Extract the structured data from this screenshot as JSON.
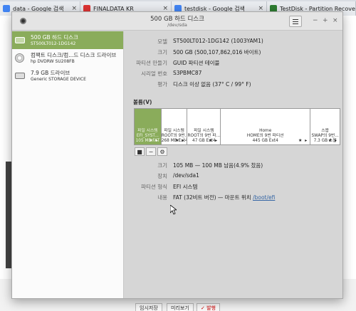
{
  "browser": {
    "tabs": [
      {
        "label": "data - Google 검색",
        "icon_color": "#4285f4"
      },
      {
        "label": "FINALDATA KR",
        "icon_color": "#d33"
      },
      {
        "label": "testdisk - Google 검색",
        "icon_color": "#4285f4"
      },
      {
        "label": "TestDisk - Partition Recover",
        "icon_color": "#2e7d32"
      }
    ],
    "bottom_buttons": [
      "임시저장",
      "미리보기",
      "✓ 발행"
    ]
  },
  "window": {
    "title": "500 GB 하드 디스크",
    "subtitle": "/dev/sda"
  },
  "devices": [
    {
      "name": "500 GB 하드 디스크",
      "detail": "ST500LT012-1DG142",
      "icon": "harddisk-icon",
      "selected": true
    },
    {
      "name": "컴팩트 디스크/컴...드 디스크 드라이브",
      "detail": "hp     DVDRW  SU208FB",
      "icon": "optical-drive-icon",
      "selected": false
    },
    {
      "name": "7.9 GB 드라이브",
      "detail": "Generic STORAGE DEVICE",
      "icon": "usb-drive-icon",
      "selected": false
    }
  ],
  "disk_info": [
    {
      "label": "모델",
      "value": "ST500LT012-1DG142 (1003YAM1)"
    },
    {
      "label": "크기",
      "value": "500 GB (500,107,862,016 바이트)"
    },
    {
      "label": "파티션 만들기",
      "value": "GUID 파티션 테이블"
    },
    {
      "label": "시리얼 번호",
      "value": "S3PBMC87"
    },
    {
      "label": "평가",
      "value": "디스크 이상 없음 (37° C / 99° F)"
    }
  ],
  "volumes_label": "볼륨(V)",
  "partitions": [
    {
      "line1": "파일 시스템",
      "line2": "EFI_SYST...",
      "line3": "105 MB FAT",
      "icons": "★ ▸",
      "selected": true
    },
    {
      "line1": "파일 시스템",
      "line2": "ROOT의 9번...",
      "line3": "268 MB Ext4",
      "icons": "★ ▸",
      "selected": false
    },
    {
      "line1": "파일 시스템",
      "line2": "ROOT의 9번 파...",
      "line3": "47 GB Ext4",
      "icons": "★ ▸",
      "selected": false
    },
    {
      "line1": "Home",
      "line2": "HOME의 9번 파티션",
      "line3": "445 GB Ext4",
      "icons": "★ ▸",
      "selected": false
    },
    {
      "line1": "스왑",
      "line2": "SWAP의 9번...",
      "line3": "7.3 GB 스왑",
      "icons": "★ ▸",
      "selected": false
    }
  ],
  "volume_tools": {
    "stop": "■",
    "remove": "−",
    "settings": "⚙"
  },
  "partition_info": [
    {
      "label": "크기",
      "value": "105 MB — 100 MB 남음(4.9% 찼음)"
    },
    {
      "label": "장치",
      "value": "/dev/sda1"
    },
    {
      "label": "파티션 형식",
      "value": "EFI 시스템"
    },
    {
      "label": "내용",
      "value": "FAT (32비트 버전) — 마운트 위치 ",
      "link": "/boot/efi"
    }
  ]
}
